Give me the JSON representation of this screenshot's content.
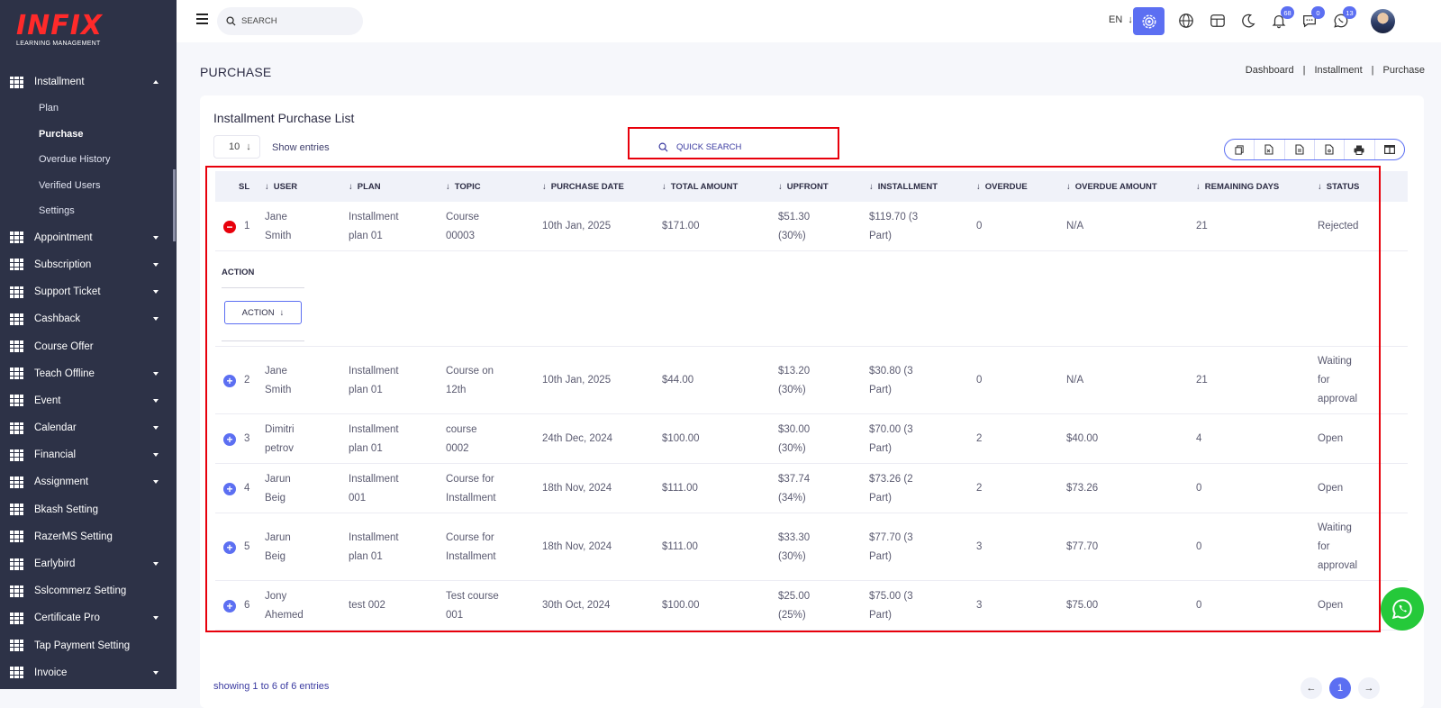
{
  "brand": {
    "name": "INFIX",
    "subtitle": "LEARNING MANAGEMENT"
  },
  "sidebar": {
    "active_group": "Installment",
    "installment_label": "Installment",
    "installment_sub": [
      "Plan",
      "Purchase",
      "Overdue History",
      "Verified Users",
      "Settings"
    ],
    "items": [
      {
        "label": "Appointment",
        "caret": true
      },
      {
        "label": "Subscription",
        "caret": true
      },
      {
        "label": "Support Ticket",
        "caret": true
      },
      {
        "label": "Cashback",
        "caret": true
      },
      {
        "label": "Course Offer",
        "caret": false
      },
      {
        "label": "Teach Offline",
        "caret": true
      },
      {
        "label": "Event",
        "caret": true
      },
      {
        "label": "Calendar",
        "caret": true
      },
      {
        "label": "Financial",
        "caret": true
      },
      {
        "label": "Assignment",
        "caret": true
      },
      {
        "label": "Bkash Setting",
        "caret": false
      },
      {
        "label": "RazerMS Setting",
        "caret": false
      },
      {
        "label": "Earlybird",
        "caret": true
      },
      {
        "label": "Sslcommerz Setting",
        "caret": false
      },
      {
        "label": "Certificate Pro",
        "caret": true
      },
      {
        "label": "Tap Payment Setting",
        "caret": false
      },
      {
        "label": "Invoice",
        "caret": true
      }
    ]
  },
  "topbar": {
    "search_placeholder": "SEARCH",
    "language": "EN",
    "notifications_count": "68",
    "messages_count": "0",
    "whatsapp_count": "13"
  },
  "page": {
    "title": "PURCHASE",
    "breadcrumb": [
      "Dashboard",
      "Installment",
      "Purchase"
    ]
  },
  "card": {
    "title": "Installment Purchase List",
    "entries_value": "10",
    "entries_label": "Show entries",
    "quick_search_placeholder": "QUICK SEARCH",
    "showing_text": "showing 1 to 6 of 6 entries",
    "current_page": "1"
  },
  "table": {
    "columns": [
      "SL",
      "USER",
      "PLAN",
      "TOPIC",
      "PURCHASE DATE",
      "TOTAL AMOUNT",
      "UPFRONT",
      "INSTALLMENT",
      "OVERDUE",
      "OVERDUE AMOUNT",
      "REMAINING DAYS",
      "STATUS"
    ],
    "detail": {
      "label": "ACTION",
      "button": "ACTION"
    },
    "rows": [
      {
        "sl": "1",
        "user": [
          "Jane",
          "Smith"
        ],
        "plan": [
          "Installment",
          "plan 01"
        ],
        "topic": [
          "Course",
          "00003"
        ],
        "date": "10th Jan, 2025",
        "total": "$171.00",
        "upfront": [
          "$51.30",
          "(30%)"
        ],
        "installment": [
          "$119.70 (3",
          "Part)"
        ],
        "overdue": "0",
        "overdue_amount": "N/A",
        "remaining": "21",
        "status": [
          "Rejected"
        ],
        "expanded": true
      },
      {
        "sl": "2",
        "user": [
          "Jane",
          "Smith"
        ],
        "plan": [
          "Installment",
          "plan 01"
        ],
        "topic": [
          "Course on",
          "12th"
        ],
        "date": "10th Jan, 2025",
        "total": "$44.00",
        "upfront": [
          "$13.20",
          "(30%)"
        ],
        "installment": [
          "$30.80 (3",
          "Part)"
        ],
        "overdue": "0",
        "overdue_amount": "N/A",
        "remaining": "21",
        "status": [
          "Waiting",
          "for",
          "approval"
        ],
        "expanded": false
      },
      {
        "sl": "3",
        "user": [
          "Dimitri",
          "petrov"
        ],
        "plan": [
          "Installment",
          "plan 01"
        ],
        "topic": [
          "course",
          "0002"
        ],
        "date": "24th Dec, 2024",
        "total": "$100.00",
        "upfront": [
          "$30.00",
          "(30%)"
        ],
        "installment": [
          "$70.00 (3",
          "Part)"
        ],
        "overdue": "2",
        "overdue_amount": "$40.00",
        "remaining": "4",
        "status": [
          "Open"
        ],
        "expanded": false
      },
      {
        "sl": "4",
        "user": [
          "Jarun",
          "Beig"
        ],
        "plan": [
          "Installment",
          "001"
        ],
        "topic": [
          "Course for",
          "Installment"
        ],
        "date": "18th Nov, 2024",
        "total": "$111.00",
        "upfront": [
          "$37.74",
          "(34%)"
        ],
        "installment": [
          "$73.26 (2",
          "Part)"
        ],
        "overdue": "2",
        "overdue_amount": "$73.26",
        "remaining": "0",
        "status": [
          "Open"
        ],
        "expanded": false
      },
      {
        "sl": "5",
        "user": [
          "Jarun",
          "Beig"
        ],
        "plan": [
          "Installment",
          "plan 01"
        ],
        "topic": [
          "Course for",
          "Installment"
        ],
        "date": "18th Nov, 2024",
        "total": "$111.00",
        "upfront": [
          "$33.30",
          "(30%)"
        ],
        "installment": [
          "$77.70 (3",
          "Part)"
        ],
        "overdue": "3",
        "overdue_amount": "$77.70",
        "remaining": "0",
        "status": [
          "Waiting",
          "for",
          "approval"
        ],
        "expanded": false
      },
      {
        "sl": "6",
        "user": [
          "Jony",
          "Ahemed"
        ],
        "plan": [
          "test 002"
        ],
        "topic": [
          "Test course",
          "001"
        ],
        "date": "30th Oct, 2024",
        "total": "$100.00",
        "upfront": [
          "$25.00",
          "(25%)"
        ],
        "installment": [
          "$75.00 (3",
          "Part)"
        ],
        "overdue": "3",
        "overdue_amount": "$75.00",
        "remaining": "0",
        "status": [
          "Open"
        ],
        "expanded": false
      }
    ]
  },
  "colors": {
    "accent": "#5c6ff2",
    "sidebar_bg": "#2d3247",
    "highlight": "#e8000b",
    "whatsapp": "#25c93a"
  }
}
